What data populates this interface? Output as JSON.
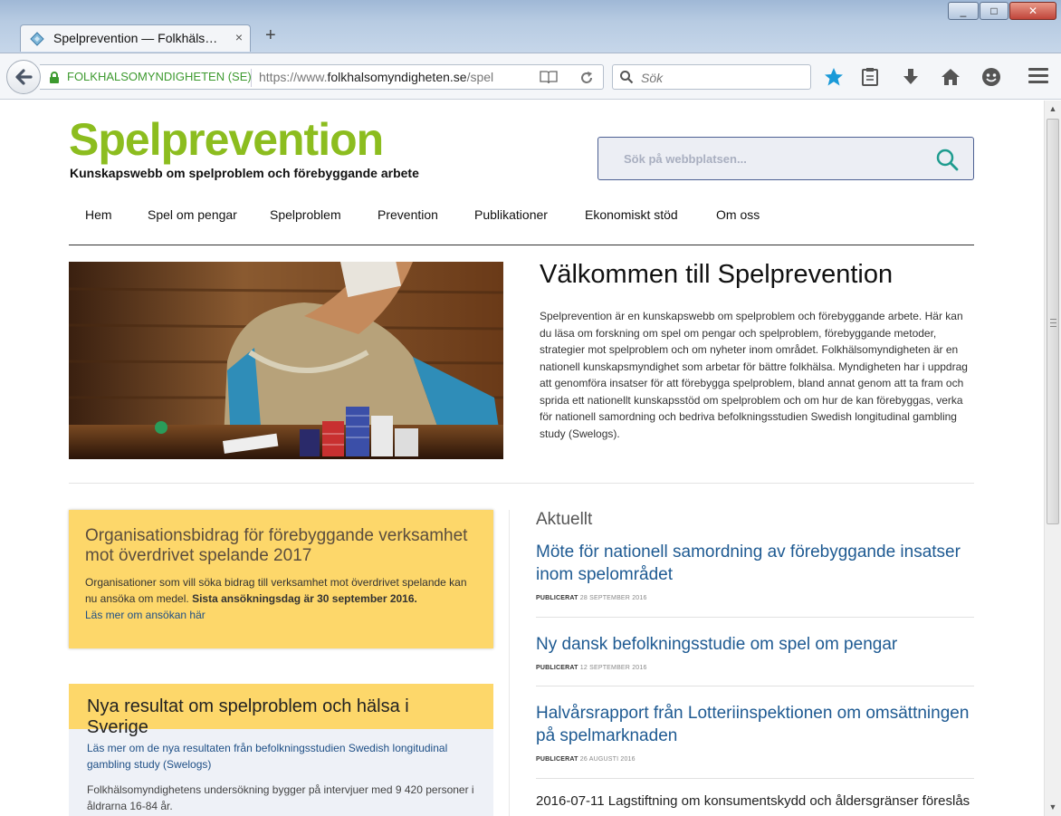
{
  "browser": {
    "tab_title": "Spelprevention — Folkhäls…",
    "tab_close": "×",
    "new_tab": "+",
    "site_identity": "FOLKHALSOMYNDIGHETEN (SE)",
    "url_prefix": "https://www.",
    "url_domain": "folkhalsomyndigheten.se",
    "url_path": "/spel",
    "search_placeholder": "Sök",
    "window_buttons": [
      "_",
      "□",
      "✕"
    ],
    "toolbar_icons": [
      "bookmark-star-icon",
      "reading-list-icon",
      "download-icon",
      "home-icon",
      "smiley-icon",
      "menu-icon"
    ],
    "accent": "#1a9ad8"
  },
  "site": {
    "logo": "Spelprevention",
    "tagline": "Kunskapswebb om spelproblem och förebyggande arbete",
    "search_placeholder": "Sök på webbplatsen...",
    "brand_green": "#8cbd1f",
    "highlight_yellow": "#fdd76a"
  },
  "nav": [
    "Hem",
    "Spel om pengar",
    "Spelproblem",
    "Prevention",
    "Publikationer",
    "Ekonomiskt stöd",
    "Om oss"
  ],
  "welcome": {
    "heading": "Välkommen till Spelprevention",
    "body": "Spelprevention är en kunskapswebb om spelproblem och förebyggande arbete. Här kan du läsa om forskning om spel om pengar och spelproblem, förebyggande metoder, strategier mot spelproblem och om nyheter inom området. Folkhälsomyndigheten är en nationell kunskapsmyndighet som arbetar för bättre folkhälsa. Myndigheten har i uppdrag att genomföra insatser för att förebygga spelproblem, bland annat genom att ta fram och sprida ett nationellt kunskapsstöd om spelproblem och om hur de kan förebyggas, verka för nationell samordning och bedriva befolkningsstudien Swedish longitudinal gambling study (Swelogs)."
  },
  "box1": {
    "title": "Organisationsbidrag för förebyggande verksamhet mot överdrivet spelande 2017",
    "text": "Organisationer som vill söka bidrag till verksamhet mot överdrivet spelande kan nu ansöka om medel. ",
    "deadline": "Sista ansökningsdag är 30 september 2016.",
    "link": "Läs mer om ansökan här"
  },
  "box2": {
    "title": "Nya resultat om spelproblem och hälsa i Sverige",
    "link": "Läs mer om de nya resultaten från befolkningsstudien Swedish longitudinal gambling study (Swelogs)",
    "text": "Folkhälsomyndighetens undersökning bygger på intervjuer med 9 420 personer i åldrarna 16-84 år."
  },
  "news": {
    "heading": "Aktuellt",
    "published_label": "PUBLICERAT",
    "items": [
      {
        "title": "Möte för nationell samordning av förebyggande insatser inom spelområdet",
        "date": "28 SEPTEMBER 2016"
      },
      {
        "title": "Ny dansk befolkningsstudie om spel om pengar",
        "date": "12 SEPTEMBER 2016"
      },
      {
        "title": "Halvårsrapport från Lotteriinspektionen om omsättningen på spelmarknaden",
        "date": "26 AUGUSTI 2016"
      }
    ],
    "last_date": "2016-07-11",
    "last_title": "Lagstiftning om konsumentskydd och åldersgränser föreslås"
  }
}
